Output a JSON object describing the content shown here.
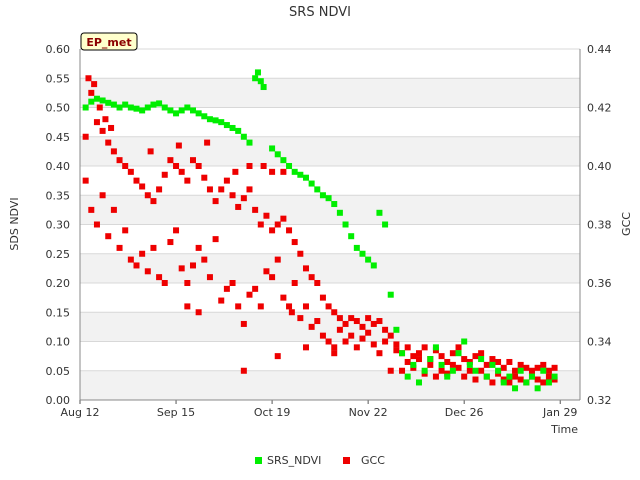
{
  "chart_data": {
    "type": "scatter",
    "title": "SRS NDVI",
    "badge": "EP_met",
    "xlabel": "Time",
    "ylabel_left": "SDS NDVI",
    "ylabel_right": "GCC",
    "x_ticks": [
      "Aug 12",
      "Sep 15",
      "Oct 19",
      "Nov 22",
      "Dec 26",
      "Jan 29"
    ],
    "x_tick_days": [
      0,
      34,
      68,
      102,
      136,
      170
    ],
    "xlim_days": [
      0,
      177
    ],
    "ylim_left": [
      0,
      0.6
    ],
    "y_ticks_left": [
      "0.00",
      "0.05",
      "0.10",
      "0.15",
      "0.20",
      "0.25",
      "0.30",
      "0.35",
      "0.40",
      "0.45",
      "0.50",
      "0.55",
      "0.60"
    ],
    "ylim_right": [
      0.32,
      0.44
    ],
    "y_ticks_right": [
      "0.32",
      "0.34",
      "0.36",
      "0.38",
      "0.40",
      "0.42",
      "0.44"
    ],
    "grid": true,
    "legend_position": "bottom",
    "series": [
      {
        "name": "SRS_NDVI",
        "color": "#00ee00",
        "axis": "left",
        "points": [
          [
            2,
            0.5
          ],
          [
            4,
            0.51
          ],
          [
            6,
            0.515
          ],
          [
            8,
            0.512
          ],
          [
            10,
            0.508
          ],
          [
            12,
            0.505
          ],
          [
            14,
            0.5
          ],
          [
            16,
            0.505
          ],
          [
            18,
            0.5
          ],
          [
            20,
            0.498
          ],
          [
            22,
            0.495
          ],
          [
            24,
            0.5
          ],
          [
            26,
            0.505
          ],
          [
            28,
            0.507
          ],
          [
            30,
            0.5
          ],
          [
            32,
            0.495
          ],
          [
            34,
            0.49
          ],
          [
            36,
            0.495
          ],
          [
            38,
            0.5
          ],
          [
            40,
            0.495
          ],
          [
            42,
            0.49
          ],
          [
            44,
            0.485
          ],
          [
            46,
            0.48
          ],
          [
            48,
            0.478
          ],
          [
            50,
            0.475
          ],
          [
            52,
            0.47
          ],
          [
            54,
            0.465
          ],
          [
            56,
            0.46
          ],
          [
            58,
            0.45
          ],
          [
            60,
            0.44
          ],
          [
            62,
            0.55
          ],
          [
            63,
            0.56
          ],
          [
            64,
            0.545
          ],
          [
            65,
            0.535
          ],
          [
            68,
            0.43
          ],
          [
            70,
            0.42
          ],
          [
            72,
            0.41
          ],
          [
            74,
            0.4
          ],
          [
            76,
            0.39
          ],
          [
            78,
            0.385
          ],
          [
            80,
            0.38
          ],
          [
            82,
            0.37
          ],
          [
            84,
            0.36
          ],
          [
            86,
            0.35
          ],
          [
            88,
            0.345
          ],
          [
            90,
            0.335
          ],
          [
            92,
            0.32
          ],
          [
            94,
            0.3
          ],
          [
            96,
            0.28
          ],
          [
            98,
            0.26
          ],
          [
            100,
            0.25
          ],
          [
            102,
            0.24
          ],
          [
            104,
            0.23
          ],
          [
            106,
            0.32
          ],
          [
            108,
            0.3
          ],
          [
            110,
            0.18
          ],
          [
            112,
            0.12
          ],
          [
            114,
            0.08
          ],
          [
            116,
            0.04
          ],
          [
            118,
            0.06
          ],
          [
            120,
            0.03
          ],
          [
            122,
            0.05
          ],
          [
            124,
            0.07
          ],
          [
            126,
            0.09
          ],
          [
            128,
            0.06
          ],
          [
            130,
            0.04
          ],
          [
            132,
            0.05
          ],
          [
            134,
            0.08
          ],
          [
            136,
            0.1
          ],
          [
            138,
            0.06
          ],
          [
            140,
            0.05
          ],
          [
            142,
            0.07
          ],
          [
            144,
            0.04
          ],
          [
            146,
            0.06
          ],
          [
            148,
            0.05
          ],
          [
            150,
            0.03
          ],
          [
            152,
            0.04
          ],
          [
            154,
            0.02
          ],
          [
            156,
            0.05
          ],
          [
            158,
            0.03
          ],
          [
            160,
            0.04
          ],
          [
            162,
            0.02
          ],
          [
            164,
            0.05
          ],
          [
            166,
            0.03
          ],
          [
            168,
            0.04
          ]
        ]
      },
      {
        "name": "GCC",
        "color": "#ee0000",
        "axis": "right",
        "points": [
          [
            2,
            0.41
          ],
          [
            4,
            0.425
          ],
          [
            6,
            0.415
          ],
          [
            8,
            0.412
          ],
          [
            10,
            0.408
          ],
          [
            12,
            0.405
          ],
          [
            14,
            0.402
          ],
          [
            16,
            0.4
          ],
          [
            18,
            0.398
          ],
          [
            20,
            0.395
          ],
          [
            22,
            0.393
          ],
          [
            24,
            0.39
          ],
          [
            26,
            0.388
          ],
          [
            28,
            0.392
          ],
          [
            30,
            0.397
          ],
          [
            32,
            0.402
          ],
          [
            34,
            0.4
          ],
          [
            36,
            0.398
          ],
          [
            38,
            0.395
          ],
          [
            40,
            0.402
          ],
          [
            42,
            0.4
          ],
          [
            44,
            0.396
          ],
          [
            46,
            0.392
          ],
          [
            48,
            0.388
          ],
          [
            50,
            0.392
          ],
          [
            52,
            0.395
          ],
          [
            54,
            0.39
          ],
          [
            56,
            0.386
          ],
          [
            58,
            0.389
          ],
          [
            60,
            0.392
          ],
          [
            62,
            0.385
          ],
          [
            64,
            0.38
          ],
          [
            66,
            0.383
          ],
          [
            68,
            0.378
          ],
          [
            70,
            0.38
          ],
          [
            72,
            0.382
          ],
          [
            74,
            0.378
          ],
          [
            76,
            0.374
          ],
          [
            78,
            0.37
          ],
          [
            80,
            0.365
          ],
          [
            82,
            0.362
          ],
          [
            84,
            0.36
          ],
          [
            86,
            0.355
          ],
          [
            88,
            0.352
          ],
          [
            90,
            0.35
          ],
          [
            92,
            0.348
          ],
          [
            94,
            0.346
          ],
          [
            96,
            0.348
          ],
          [
            98,
            0.347
          ],
          [
            100,
            0.345
          ],
          [
            102,
            0.348
          ],
          [
            104,
            0.346
          ],
          [
            106,
            0.347
          ],
          [
            108,
            0.344
          ],
          [
            110,
            0.342
          ],
          [
            112,
            0.339
          ],
          [
            114,
            0.336
          ],
          [
            116,
            0.338
          ],
          [
            118,
            0.335
          ],
          [
            120,
            0.336
          ],
          [
            122,
            0.338
          ],
          [
            124,
            0.334
          ],
          [
            126,
            0.337
          ],
          [
            128,
            0.335
          ],
          [
            130,
            0.333
          ],
          [
            132,
            0.336
          ],
          [
            134,
            0.338
          ],
          [
            136,
            0.334
          ],
          [
            138,
            0.333
          ],
          [
            140,
            0.335
          ],
          [
            142,
            0.336
          ],
          [
            144,
            0.332
          ],
          [
            146,
            0.334
          ],
          [
            148,
            0.333
          ],
          [
            150,
            0.331
          ],
          [
            152,
            0.333
          ],
          [
            154,
            0.33
          ],
          [
            156,
            0.332
          ],
          [
            158,
            0.331
          ],
          [
            160,
            0.33
          ],
          [
            162,
            0.331
          ],
          [
            164,
            0.332
          ],
          [
            166,
            0.33
          ],
          [
            168,
            0.331
          ],
          [
            2,
            0.395
          ],
          [
            4,
            0.385
          ],
          [
            6,
            0.38
          ],
          [
            8,
            0.39
          ],
          [
            10,
            0.376
          ],
          [
            12,
            0.385
          ],
          [
            14,
            0.372
          ],
          [
            16,
            0.378
          ],
          [
            18,
            0.368
          ],
          [
            20,
            0.366
          ],
          [
            22,
            0.37
          ],
          [
            24,
            0.364
          ],
          [
            26,
            0.372
          ],
          [
            28,
            0.362
          ],
          [
            30,
            0.36
          ],
          [
            32,
            0.374
          ],
          [
            34,
            0.378
          ],
          [
            36,
            0.365
          ],
          [
            38,
            0.36
          ],
          [
            40,
            0.366
          ],
          [
            42,
            0.372
          ],
          [
            44,
            0.368
          ],
          [
            46,
            0.362
          ],
          [
            48,
            0.375
          ],
          [
            50,
            0.354
          ],
          [
            52,
            0.358
          ],
          [
            54,
            0.36
          ],
          [
            56,
            0.352
          ],
          [
            58,
            0.346
          ],
          [
            60,
            0.356
          ],
          [
            62,
            0.358
          ],
          [
            64,
            0.352
          ],
          [
            66,
            0.364
          ],
          [
            68,
            0.362
          ],
          [
            70,
            0.368
          ],
          [
            72,
            0.355
          ],
          [
            74,
            0.352
          ],
          [
            76,
            0.36
          ],
          [
            78,
            0.348
          ],
          [
            80,
            0.352
          ],
          [
            82,
            0.345
          ],
          [
            84,
            0.347
          ],
          [
            86,
            0.342
          ],
          [
            88,
            0.34
          ],
          [
            90,
            0.338
          ],
          [
            92,
            0.344
          ],
          [
            94,
            0.34
          ],
          [
            96,
            0.342
          ],
          [
            98,
            0.338
          ],
          [
            100,
            0.341
          ],
          [
            102,
            0.343
          ],
          [
            104,
            0.339
          ],
          [
            106,
            0.336
          ],
          [
            108,
            0.34
          ],
          [
            110,
            0.33
          ],
          [
            112,
            0.337
          ],
          [
            114,
            0.33
          ],
          [
            116,
            0.333
          ],
          [
            118,
            0.331
          ],
          [
            120,
            0.334
          ],
          [
            122,
            0.329
          ],
          [
            124,
            0.332
          ],
          [
            126,
            0.328
          ],
          [
            128,
            0.33
          ],
          [
            130,
            0.329
          ],
          [
            132,
            0.332
          ],
          [
            134,
            0.331
          ],
          [
            136,
            0.328
          ],
          [
            138,
            0.33
          ],
          [
            140,
            0.327
          ],
          [
            142,
            0.33
          ],
          [
            144,
            0.328
          ],
          [
            146,
            0.326
          ],
          [
            148,
            0.329
          ],
          [
            150,
            0.327
          ],
          [
            152,
            0.326
          ],
          [
            154,
            0.328
          ],
          [
            156,
            0.327
          ],
          [
            158,
            0.326
          ],
          [
            160,
            0.328
          ],
          [
            162,
            0.327
          ],
          [
            164,
            0.326
          ],
          [
            166,
            0.328
          ],
          [
            168,
            0.327
          ],
          [
            3,
            0.43
          ],
          [
            5,
            0.428
          ],
          [
            7,
            0.42
          ],
          [
            9,
            0.416
          ],
          [
            11,
            0.413
          ],
          [
            25,
            0.405
          ],
          [
            35,
            0.407
          ],
          [
            45,
            0.408
          ],
          [
            55,
            0.398
          ],
          [
            65,
            0.4
          ],
          [
            58,
            0.33
          ],
          [
            70,
            0.335
          ],
          [
            80,
            0.338
          ],
          [
            90,
            0.336
          ],
          [
            38,
            0.352
          ],
          [
            42,
            0.35
          ],
          [
            72,
            0.398
          ],
          [
            60,
            0.4
          ],
          [
            68,
            0.398
          ],
          [
            75,
            0.35
          ]
        ]
      }
    ]
  }
}
